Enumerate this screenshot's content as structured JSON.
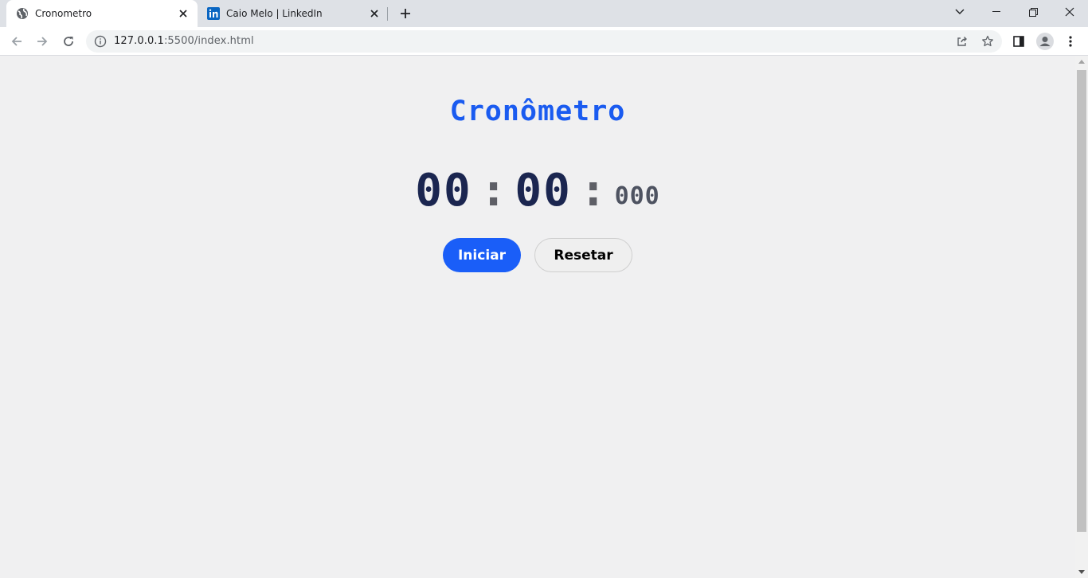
{
  "browser": {
    "tabs": [
      {
        "title": "Cronometro",
        "active": true,
        "favicon": "globe-icon"
      },
      {
        "title": "Caio Melo | LinkedIn",
        "active": false,
        "favicon": "linkedin-icon"
      }
    ],
    "url_host": "127.0.0.1",
    "url_rest": ":5500/index.html"
  },
  "app": {
    "title": "Cronômetro",
    "minutes": "00",
    "seconds": "00",
    "separator": ":",
    "milliseconds": "000",
    "start_label": "Iniciar",
    "reset_label": "Resetar"
  },
  "colors": {
    "accent": "#1a5bf0",
    "digits": "#1b2650",
    "background": "#f0f0f1"
  }
}
